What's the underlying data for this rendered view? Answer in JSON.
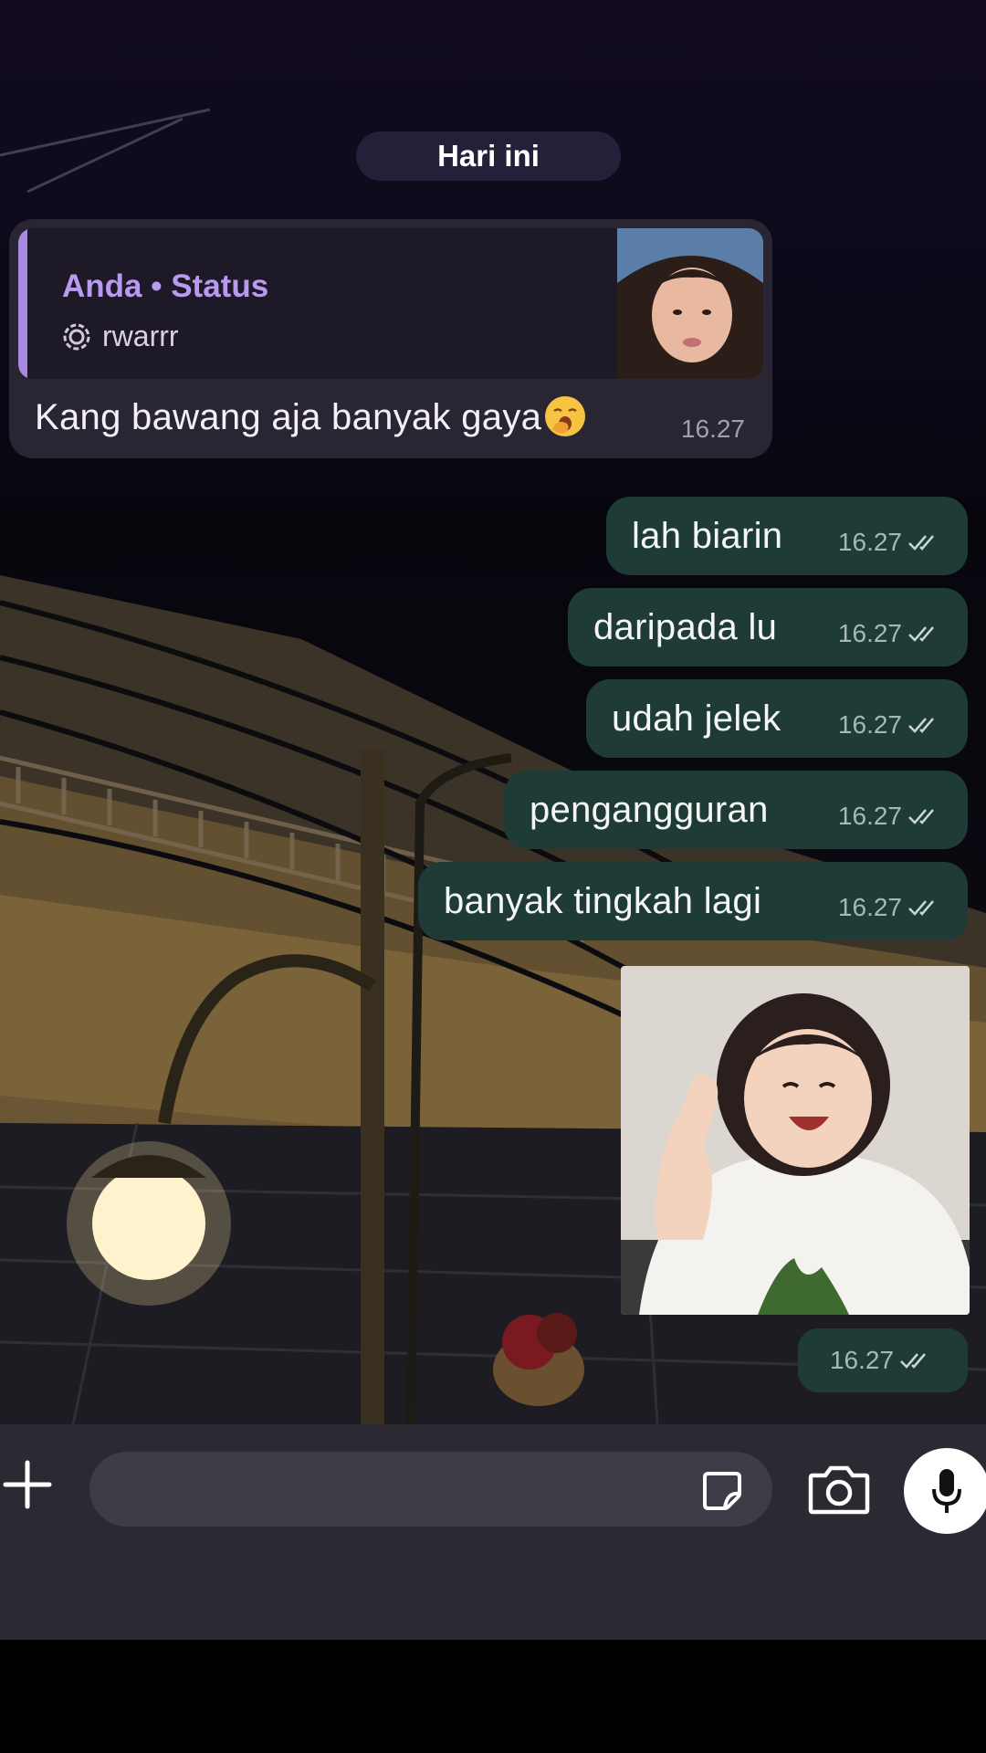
{
  "date_divider": "Hari ini",
  "incoming": {
    "quote_title": "Anda • Status",
    "quote_sub": "rwarrr",
    "text": "Kang bawang aja banyak gaya",
    "emoji": "yawning-face",
    "time": "16.27"
  },
  "outgoing": [
    {
      "text": "lah biarin",
      "time": "16.27"
    },
    {
      "text": "daripada lu",
      "time": "16.27"
    },
    {
      "text": "udah jelek",
      "time": "16.27"
    },
    {
      "text": "pengangguran",
      "time": "16.27"
    },
    {
      "text": "banyak tingkah lagi",
      "time": "16.27"
    }
  ],
  "image_message": {
    "time": "16.27"
  },
  "input_bar": {
    "placeholder": "",
    "icons": [
      "plus-icon",
      "sticker-icon",
      "camera-icon",
      "microphone-icon"
    ]
  },
  "colors": {
    "incoming_bubble": "#2a2533",
    "outgoing_bubble": "#1f3b36",
    "quote_accent": "#b99af0"
  }
}
